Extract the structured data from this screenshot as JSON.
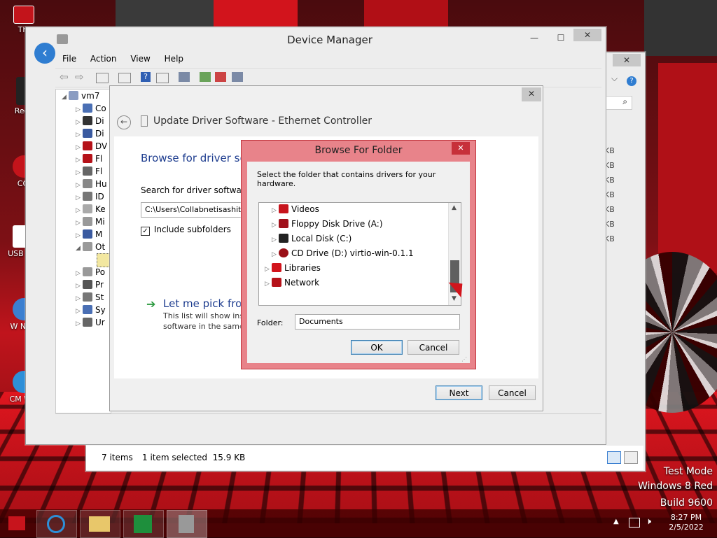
{
  "device_manager": {
    "title": "Device Manager",
    "menu": [
      "File",
      "Action",
      "View",
      "Help"
    ],
    "root_node": "vm7",
    "tree_items": [
      "Co",
      "Di",
      "Di",
      "DV",
      "Fl",
      "Fl",
      "Hu",
      "ID",
      "Ke",
      "Mi",
      "M",
      "Ot",
      "Po",
      "Pr",
      "St",
      "Sy",
      "Ur"
    ]
  },
  "explorer_behind": {
    "size_column": [
      "KB",
      "KB",
      "KB",
      "KB",
      "KB",
      "KB",
      "KB"
    ],
    "status_items": "7 items",
    "status_selected": "1 item selected  15.9 KB"
  },
  "update_driver": {
    "title": "Update Driver Software - Ethernet Controller",
    "heading": "Browse for driver sof",
    "search_label": "Search for driver software ir",
    "path_value": "C:\\Users\\Collabnetisashitc",
    "include_subfolders_label": "Include subfolders",
    "include_subfolders_checked": true,
    "pick_heading": "Let me pick from",
    "pick_desc_line1": "This list will show inst",
    "pick_desc_line2": "software in the same",
    "next_label": "Next",
    "cancel_label": "Cancel"
  },
  "browse_folder": {
    "title": "Browse For Folder",
    "instruction": "Select the folder that contains drivers for your hardware.",
    "tree": [
      {
        "label": "Videos",
        "icon": "videos-folder-icon"
      },
      {
        "label": "Floppy Disk Drive (A:)",
        "icon": "floppy-drive-icon"
      },
      {
        "label": "Local Disk (C:)",
        "icon": "local-disk-icon"
      },
      {
        "label": "CD Drive (D:) virtio-win-0.1.1",
        "icon": "cd-drive-icon"
      },
      {
        "label": "Libraries",
        "icon": "libraries-icon"
      },
      {
        "label": "Network",
        "icon": "network-icon"
      }
    ],
    "folder_label": "Folder:",
    "folder_value": "Documents",
    "ok_label": "OK",
    "cancel_label": "Cancel"
  },
  "desktop_icons": [
    "Thi",
    "Recy",
    "CCl",
    "USB Sec",
    "W Navi",
    "CM Wel"
  ],
  "watermark": {
    "line1": "Test Mode",
    "line2": "Windows 8 Red",
    "line3": "Build 9600"
  },
  "taskbar": {
    "time": "8:27 PM",
    "date": "2/5/2022"
  },
  "colors": {
    "dialog_border": "#d9444e",
    "heading_blue": "#1e3d8f",
    "link_green": "#2b9a3f",
    "accent_blue": "#2f7dd1"
  }
}
